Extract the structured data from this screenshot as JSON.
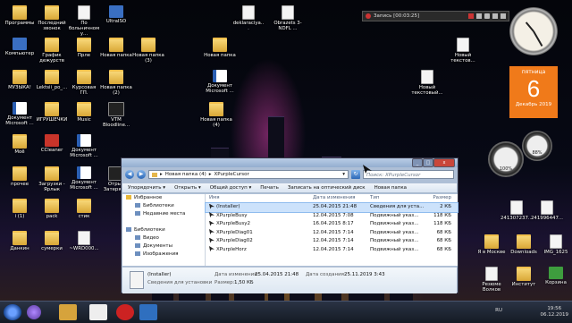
{
  "desktop_icons": [
    {
      "id": "programmy",
      "label": "Программы",
      "type": "folder"
    },
    {
      "id": "posledniy",
      "label": "Последний звонок",
      "type": "folder"
    },
    {
      "id": "po-bolnichnomu",
      "label": "По больничному...",
      "type": "doc"
    },
    {
      "id": "ultraiso",
      "label": "UltraISO",
      "type": "app"
    },
    {
      "id": "kompyuter",
      "label": "Компьютер",
      "type": "app"
    },
    {
      "id": "grafik",
      "label": "График дежурств",
      "type": "folder"
    },
    {
      "id": "prle",
      "label": "Прле",
      "type": "folder"
    },
    {
      "id": "novaya-papka",
      "label": "Новая папка",
      "type": "folder"
    },
    {
      "id": "novaya-papka-3",
      "label": "Новая папка (3)",
      "type": "folder"
    },
    {
      "id": "muzyka",
      "label": "МУЗЫКА!",
      "type": "folder"
    },
    {
      "id": "lektsii",
      "label": "Lektsii_po_...",
      "type": "folder"
    },
    {
      "id": "kursovaya",
      "label": "Курсовая ГП.",
      "type": "folder"
    },
    {
      "id": "novaya-papka-2",
      "label": "Новая папка (2)",
      "type": "folder"
    },
    {
      "id": "dokument-ms",
      "label": "Документ Microsoft ...",
      "type": "word"
    },
    {
      "id": "igrushechki",
      "label": "ИГРУШЕЧКИ",
      "type": "folder"
    },
    {
      "id": "music",
      "label": "Music",
      "type": "folder"
    },
    {
      "id": "vtm",
      "label": "VTM Bloodline...",
      "type": "film"
    },
    {
      "id": "moe",
      "label": "Моё",
      "type": "folder"
    },
    {
      "id": "ccleaner",
      "label": "CCleaner",
      "type": "red"
    },
    {
      "id": "dokument-ms-2",
      "label": "Документ Microsoft ...",
      "type": "word"
    },
    {
      "id": "prochee",
      "label": "прочее",
      "type": "folder"
    },
    {
      "id": "zagruzki",
      "label": "Загрузки - Ярлык",
      "type": "folder"
    },
    {
      "id": "dokument-ms-3",
      "label": "Документ Microsoft ...",
      "type": "word"
    },
    {
      "id": "otryv",
      "label": "Отрыв Затерян...",
      "type": "film"
    },
    {
      "id": "i1",
      "label": "i (1)",
      "type": "folder"
    },
    {
      "id": "pack",
      "label": "pack",
      "type": "folder"
    },
    {
      "id": "stik",
      "label": "стик",
      "type": "folder"
    },
    {
      "id": "dankin",
      "label": "Данкин",
      "type": "folder"
    },
    {
      "id": "sumerki",
      "label": "сумерки",
      "type": "folder"
    },
    {
      "id": "wrd",
      "label": "~WRD000...",
      "type": "doc"
    },
    {
      "id": "deklaraciya",
      "label": "deklaraciya...",
      "type": "doc"
    },
    {
      "id": "obrazets",
      "label": "Obrazets 3-NDFL ...",
      "type": "doc"
    },
    {
      "id": "novaya-papka-dup",
      "label": "Новая папка",
      "type": "folder"
    },
    {
      "id": "dokument-ms-4",
      "label": "Документ Microsoft ...",
      "type": "word"
    },
    {
      "id": "novyy-tekst",
      "label": "Новый текстов...",
      "type": "doc"
    },
    {
      "id": "novyy-tekst-2",
      "label": "Новый текстовый...",
      "type": "doc"
    },
    {
      "id": "novaya-papka-4",
      "label": "Новая папка (4)",
      "type": "folder"
    },
    {
      "id": "stroka-241",
      "label": "241307237...",
      "type": "doc"
    },
    {
      "id": "stroka-2419",
      "label": "241996447...",
      "type": "doc"
    },
    {
      "id": "ya-v-moskve",
      "label": "Я в Москве",
      "type": "folder"
    },
    {
      "id": "downloads",
      "label": "Downloads",
      "type": "folder"
    },
    {
      "id": "img1625",
      "label": "IMG_1625",
      "type": "doc"
    },
    {
      "id": "rezyume",
      "label": "Резюме Волков",
      "type": "doc"
    },
    {
      "id": "institut",
      "label": "Институт",
      "type": "folder"
    },
    {
      "id": "korzina",
      "label": "Корзина",
      "type": "green"
    }
  ],
  "recorder": {
    "label": "Запись [00:03:25]"
  },
  "calendar": {
    "weekday": "пятница",
    "day": "6",
    "month": "Декабрь 2019"
  },
  "gauges": {
    "cpu": "100%",
    "mem": "88%"
  },
  "explorer": {
    "breadcrumb": [
      "Новая папка (4)",
      "XPurpleCursor"
    ],
    "search_placeholder": "Поиск: XPurpleCursor",
    "toolbar": [
      "Упорядочить ▾",
      "Открыть ▾",
      "Общий доступ ▾",
      "Печать",
      "Записать на оптический диск",
      "Новая папка"
    ],
    "nav": [
      {
        "label": "Избранное",
        "kind": "star"
      },
      {
        "label": "Библиотеки",
        "kind": "sub"
      },
      {
        "label": "Недавние места",
        "kind": "sub"
      },
      {
        "label": "",
        "kind": "blank"
      },
      {
        "label": "Библиотеки",
        "kind": "head"
      },
      {
        "label": "Видео",
        "kind": "sub"
      },
      {
        "label": "Документы",
        "kind": "sub"
      },
      {
        "label": "Изображения",
        "kind": "sub"
      }
    ],
    "columns": [
      "Имя",
      "Дата изменения",
      "Тип",
      "Размер"
    ],
    "files": [
      {
        "name": "(Installer)",
        "date": "25.04.2015 21:48",
        "type": "Сведения для уста...",
        "size": "2 КБ",
        "selected": true
      },
      {
        "name": "XPurpleBusy",
        "date": "12.04.2015 7:08",
        "type": "Подвижный указ...",
        "size": "118 КБ",
        "selected": false
      },
      {
        "name": "XPurpleBusy2",
        "date": "16.04.2015 8:17",
        "type": "Подвижный указ...",
        "size": "118 КБ",
        "selected": false
      },
      {
        "name": "XPurpleDiag01",
        "date": "12.04.2015 7:14",
        "type": "Подвижный указ...",
        "size": "68 КБ",
        "selected": false
      },
      {
        "name": "XPurpleDiag02",
        "date": "12.04.2015 7:14",
        "type": "Подвижный указ...",
        "size": "68 КБ",
        "selected": false
      },
      {
        "name": "XPurpleHorz",
        "date": "12.04.2015 7:14",
        "type": "Подвижный указ...",
        "size": "68 КБ",
        "selected": false
      }
    ],
    "details": {
      "name": "(Installer)",
      "type": "Сведения для установки",
      "modified_label": "Дата изменения:",
      "modified": "25.04.2015 21:48",
      "size_label": "Размер:",
      "size": "1,50 КБ",
      "created_label": "Дата создания:",
      "created": "25.11.2019 3:43"
    }
  },
  "taskbar": {
    "lang": "RU",
    "time": "19:56",
    "date": "06.12.2019"
  }
}
